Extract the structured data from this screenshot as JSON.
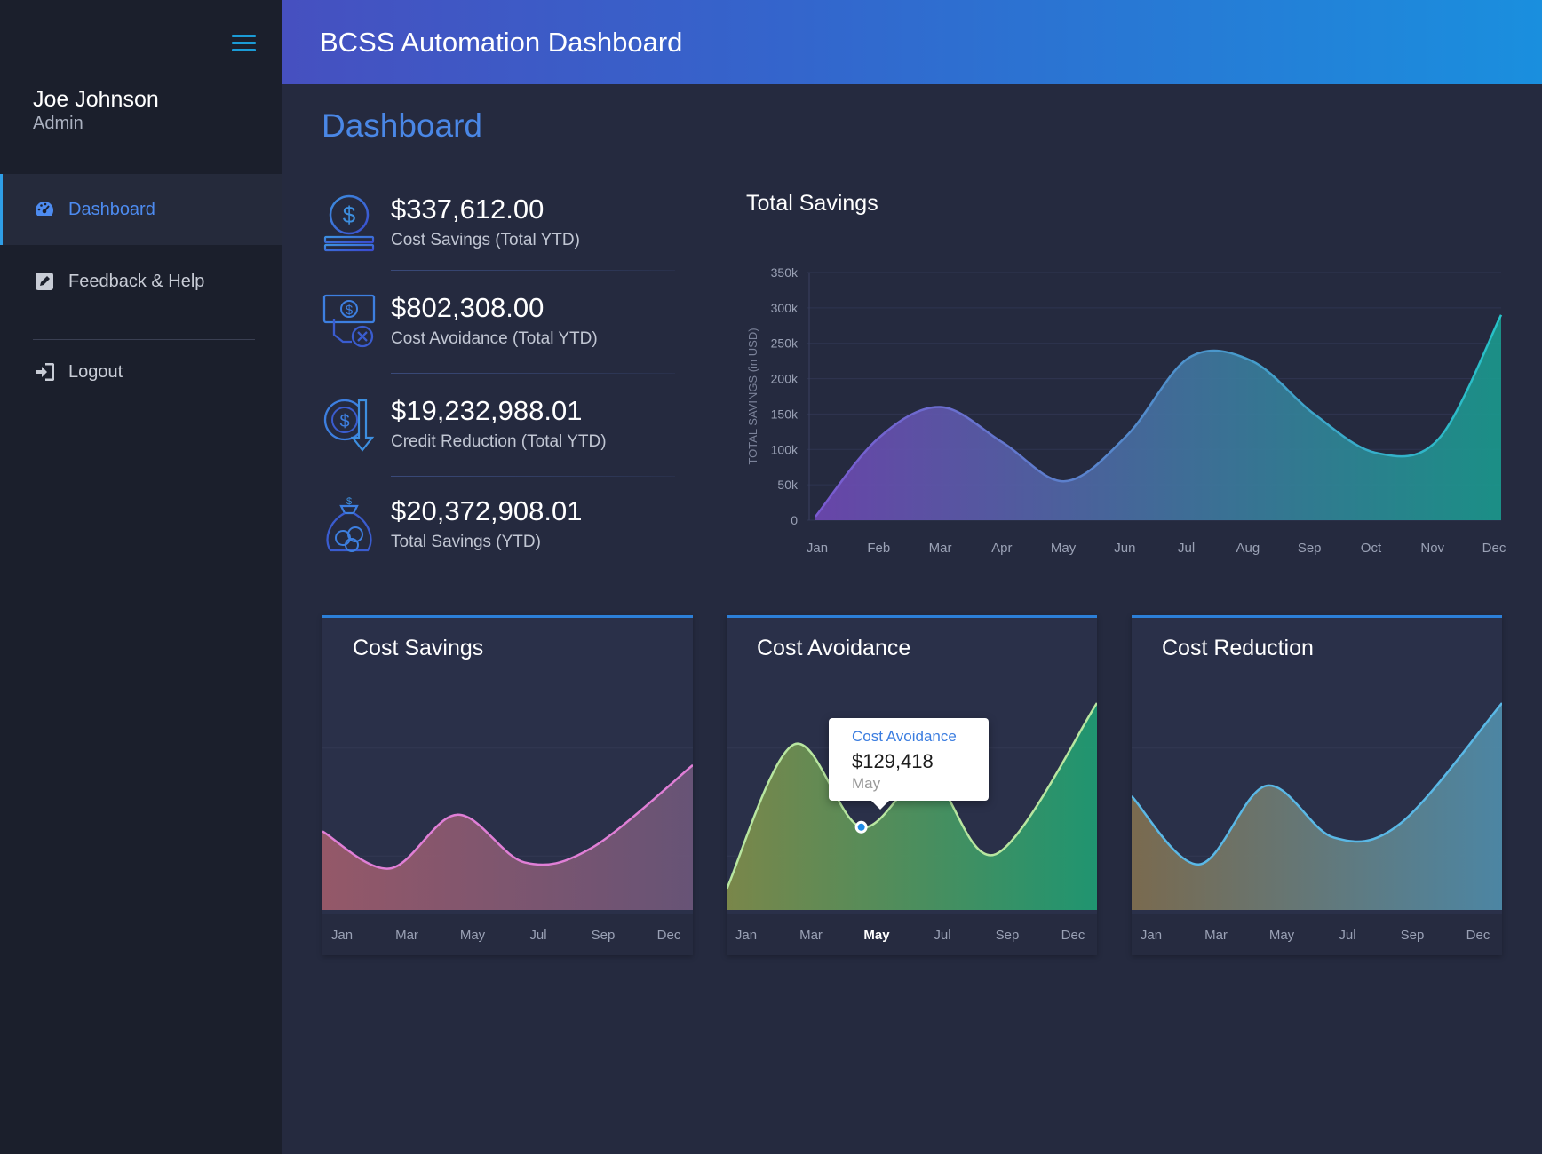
{
  "app": {
    "title": "BCSS Automation Dashboard"
  },
  "user": {
    "name": "Joe Johnson",
    "role": "Admin"
  },
  "nav": {
    "items": [
      {
        "label": "Dashboard",
        "icon": "dashboard-gauge-icon",
        "active": true
      },
      {
        "label": "Feedback & Help",
        "icon": "edit-icon",
        "active": false
      },
      {
        "label": "Logout",
        "icon": "sign-in-icon",
        "active": false
      }
    ]
  },
  "page": {
    "title": "Dashboard"
  },
  "stats": [
    {
      "value": "$337,612.00",
      "label": "Cost Savings (Total YTD)",
      "icon": "coin-stack-icon"
    },
    {
      "value": "$802,308.00",
      "label": "Cost Avoidance (Total YTD)",
      "icon": "cash-hand-icon"
    },
    {
      "value": "$19,232,988.01",
      "label": "Credit Reduction (Total YTD)",
      "icon": "coin-down-icon"
    },
    {
      "value": "$20,372,908.01",
      "label": "Total Savings (YTD)",
      "icon": "money-bag-icon"
    }
  ],
  "colors": {
    "accent": "#4a87e6",
    "header_start": "#4650c0",
    "header_end": "#1a8fde",
    "sidebar": "#1b1f2c",
    "background": "#252a3f"
  },
  "chart_data": [
    {
      "type": "area",
      "title": "Total Savings",
      "ylabel": "TOTAL SAVINGS (in USD)",
      "xlabel": "",
      "categories": [
        "Jan",
        "Feb",
        "Mar",
        "Apr",
        "May",
        "Jun",
        "Jul",
        "Aug",
        "Sep",
        "Oct",
        "Nov",
        "Dec"
      ],
      "yticks": [
        "0",
        "50k",
        "100k",
        "150k",
        "200k",
        "250k",
        "300k",
        "350k"
      ],
      "ylim": [
        0,
        350000
      ],
      "values": [
        5000,
        115000,
        160000,
        110000,
        55000,
        120000,
        230000,
        225000,
        150000,
        95000,
        115000,
        290000
      ],
      "gradient": [
        "#6f48b4",
        "#1a9a8e"
      ],
      "line_gradient": [
        "#7a5ad0",
        "#27c2c8"
      ],
      "grid": true
    },
    {
      "type": "area",
      "title": "Cost Savings",
      "categories": [
        "Jan",
        "Mar",
        "May",
        "Jul",
        "Sep",
        "Dec"
      ],
      "x": [
        0,
        2,
        4,
        6,
        8,
        11
      ],
      "values": [
        38,
        20,
        46,
        23,
        30,
        70
      ],
      "ylim": [
        0,
        100
      ],
      "gradient": [
        "#9a5a6a",
        "#6a5578"
      ],
      "line_color": "#e07fd6"
    },
    {
      "type": "area",
      "title": "Cost Avoidance",
      "categories": [
        "Jan",
        "Mar",
        "May",
        "Jul",
        "Sep",
        "Dec"
      ],
      "x": [
        0,
        2,
        4,
        6,
        8,
        11
      ],
      "values": [
        10,
        80,
        40,
        65,
        27,
        100
      ],
      "ylim": [
        0,
        100
      ],
      "highlight_index": 2,
      "gradient": [
        "#7e8b4a",
        "#1f9a72"
      ],
      "line_color": "#b8e6a0",
      "tooltip": {
        "series": "Cost Avoidance",
        "value": "$129,418",
        "month": "May"
      }
    },
    {
      "type": "area",
      "title": "Cost Reduction",
      "categories": [
        "Jan",
        "Mar",
        "May",
        "Jul",
        "Sep",
        "Dec"
      ],
      "x": [
        0,
        2,
        4,
        6,
        8,
        11
      ],
      "values": [
        55,
        22,
        60,
        35,
        42,
        100
      ],
      "ylim": [
        0,
        100
      ],
      "gradient": [
        "#7e6d4f",
        "#4e8aa8"
      ],
      "line_color": "#5ab8e6"
    }
  ]
}
